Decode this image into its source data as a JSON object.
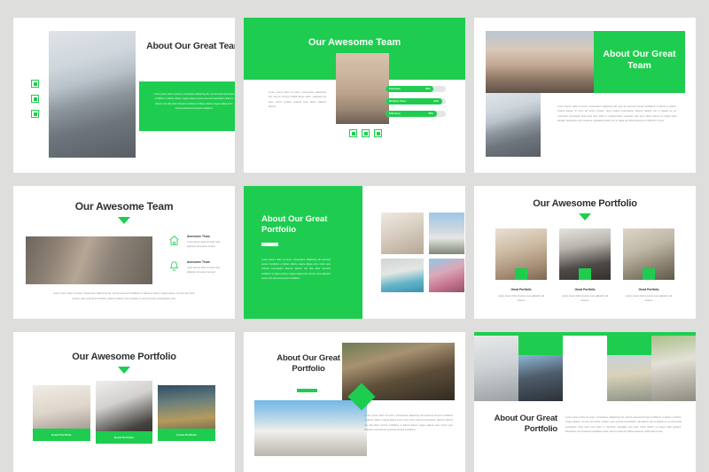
{
  "theme": {
    "accent": "#1ecd4f",
    "background": "#dededd",
    "slide_bg": "#ffffff",
    "heading": "#2f3033",
    "body_text": "#8b8d90"
  },
  "lorem": {
    "short": "Lorem ipsum dolor sit amet, consectetur adipiscing elit, sed do eiusmod tempor incididunt ut labore dolore magna aliqua.",
    "medium": "Lorem ipsum dolor sit amet, consectetur adipiscing elit, sed do eiusmod tempor incididunt ut labore et dolore magna aliqua. Ut enim ad minim veniam, quis nostrud exercitation ullamco laboris nisi ut aliquip ex ea commodo consequat.",
    "long": "Lorem ipsum dolor sit amet, consectetur adipiscing elit, sed do eiusmod tempor incididunt ut labore et dolore magna aliqua. Ut enim ad minim veniam, quis nostrud exercitation ullamco laboris nisi ut aliquip ex ea commodo consequat. Duis aute irure dolor in reprehenderit in voluptate velit esse cillum dolore eu fugiat nulla pariatur. Excepteur sint occaecat cupidatat non proident, sunt in culpa qui officia deserunt mollit anim id est laborum.",
    "tiny": "Lorem ipsum dolor sit amet cons adipiscin elit eiusmo tempor."
  },
  "slides": [
    {
      "id": "slide-1",
      "title": "About Our Great Team",
      "body": "Lorem ipsum dolor sit amet, consectetur adipiscing elit, sed do eiusmod tempor incididunt ut labore dolore magna aliqua enimis eiusmod exercitation ullamco laboris nisi utilq dolor acceras incididunt ut labore dolore magna aliqua enim minima doeiusmod tempor incididunt.",
      "social_icons": [
        "facebook-icon",
        "twitter-icon",
        "instagram-icon"
      ],
      "photo": "businessman-in-suit-photo"
    },
    {
      "id": "slide-2",
      "title": "Our Awesome Team",
      "body": "Lorem ipsum dolor sit amet, consectetur adipiscing elit, sed do tempor incidid labore dolor magnaes qui anim minim veniam nostrud nostr tation ullamco laboris.",
      "photo": "woman-with-sunglasses-photo",
      "social_icons": [
        "facebook-icon",
        "twitter-icon",
        "instagram-icon"
      ],
      "skills": [
        {
          "label": "Teamwork",
          "value": "80%",
          "pct": 80
        },
        {
          "label": "Working Times",
          "value": "94%",
          "pct": 94
        },
        {
          "label": "Efficiency",
          "value": "85%",
          "pct": 85
        }
      ]
    },
    {
      "id": "slide-3",
      "title": "About Our Great Team",
      "body": "Lorem ipsum dolor sit amet, consectetur adipiscing elit, sed do eiusmod tempor incididunt ut labore et dolore magna aliqua. Ut enim ad minim veniam, quis nostrud exercitation ullamco laboris nisi ut aliquip ex ea commodo consequat. Duis aute irure dolor in reprehenderit voluptate velit esse cillum dolore eu fugiat nulla pariatur. Excepteur sint occaecat cupidatat proide sunt in culpa qui officia deserunt mollit anim id est.",
      "photos": [
        "woman-street-photo",
        "businessman-in-suit-photo"
      ]
    },
    {
      "id": "slide-4",
      "title": "Our Awesome Team",
      "photo": "team-meeting-photo",
      "features": [
        {
          "icon": "home-icon",
          "title": "Awesome Team",
          "text": "Lorem ipsum dolor sit amet cons adipiscin elit eiusmo tempor"
        },
        {
          "icon": "bell-icon",
          "title": "Awesome Team",
          "text": "Lorem ipsum dolor sit amet cons adipiscin elit eiusmo tempor"
        }
      ],
      "footer": "Lorem ipsum dolor sit amet, consectetur adipiscing elit, sed do eiusmod incididunt ut labore et dolore magna aliqua. Ut enim ad minim veniam, quis nostrud exercitation ullamco laboris nisi ut aliquip ex ea commodo consequatos aute."
    },
    {
      "id": "slide-5",
      "title": "About Our Great Portfolio",
      "body": "Lorem ipsum dolor sit amet, consectetur adipiscing elit eiusmod tempor incididunt ut labore dolore magna aliqua enim minim quis nostrud exercitation ullamco laboris nisi ulla dolor acuman incididunt ut labore dolore magna aliqua enim tempor quis adipiscin eiusmo do eiusmod tempor incididunt.",
      "gallery": [
        "living-room-photo",
        "modern-house-photo",
        "pool-villa-photo",
        "pink-street-photo"
      ]
    },
    {
      "id": "slide-6",
      "title": "Our Awesome Portfolio",
      "cards": [
        {
          "photo": "kitchen-wood-photo",
          "title": "Great Portfolio",
          "text": "Lorem ipsum dolor sit amet cons adipiscin elit eiusmo"
        },
        {
          "photo": "kitchen-dark-photo",
          "title": "Great Portfolio",
          "text": "Lorem ipsum dolor sit amet cons adipiscin elit eiusmo"
        },
        {
          "photo": "living-loft-photo",
          "title": "Great Portfolio",
          "text": "Lorem ipsum dolor sit amet cons adipiscin elit eiusmo"
        }
      ]
    },
    {
      "id": "slide-7",
      "title": "Our Awesome Portfolio",
      "cards": [
        {
          "photo": "white-kitchen-photo",
          "caption": "Great Portfolio"
        },
        {
          "photo": "black-white-sofa-photo",
          "caption": "Great Portfolio"
        },
        {
          "photo": "house-at-dusk-photo",
          "caption": "Great Portfolio"
        }
      ]
    },
    {
      "id": "slide-8",
      "title": "About Our Great Portfolio",
      "body": "Lorem ipsum dolor sit amet, consectetur adipiscing elit eiusmod tempor incididunt ut labore dolore magna aliqua enim minim quis nostrud exercitation ullamco laboris nisi aliq dolor acuma incididunt ut labore dolore magna aliqua enim minim quis adipiscin eiusmod do eiusmod tempor incididunt.",
      "photos": [
        "patio-lounge-photo",
        "white-villa-photo"
      ]
    },
    {
      "id": "slide-9",
      "title": "About Our Great Portfolio",
      "body": "Lorem ipsum dolor sit amet, consectetur adipiscing elit, sed do eiusmod tempor incididunt ut labore et dolore magna aliqua. Ut enim ad minim veniam, quis nostrud exercitation ulla laboris nisi ut aliquip ex ea commodo consequat. Duis aute irure dolor in reprehen voluptate velit esse cillum dolore eu fugiat nulla pariatur. Excepteur sint occaecat cupidatat proide sunt in culpa qui officia deserunt mollit anim id est.",
      "photos": [
        "white-building-photo",
        "glass-tower-photo",
        "city-skyline-photo",
        "apartment-block-photo",
        "colonial-house-photo"
      ]
    }
  ]
}
